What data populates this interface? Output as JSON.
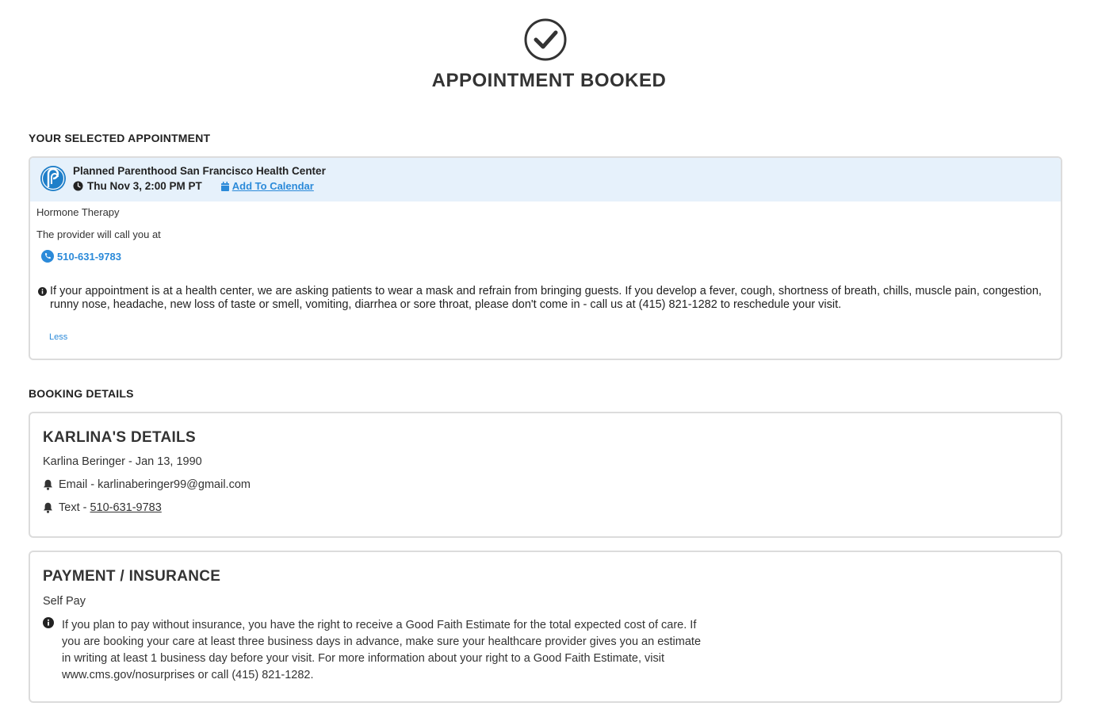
{
  "header": {
    "title": "APPOINTMENT BOOKED"
  },
  "selected_section": {
    "label": "YOUR SELECTED APPOINTMENT"
  },
  "appointment": {
    "center_name": "Planned Parenthood San Francisco Health Center",
    "datetime": "Thu Nov 3, 2:00 PM PT",
    "add_to_calendar": "Add To Calendar",
    "service": "Hormone Therapy",
    "call_note": "The provider will call you at",
    "phone": "510-631-9783",
    "covid_notice": "If your appointment is at a health center, we are asking patients to wear a mask and refrain from bringing guests. If you develop a fever, cough, shortness of breath, chills, muscle pain, congestion, runny nose, headache, new loss of taste or smell, vomiting, diarrhea or sore throat, please don't come in - call us at (415) 821-1282 to reschedule your visit.",
    "less_label": "Less"
  },
  "booking_section": {
    "label": "BOOKING DETAILS"
  },
  "patient": {
    "title": "KARLINA'S DETAILS",
    "name_dob": "Karlina Beringer - Jan 13, 1990",
    "email_line": "Email - karlinaberinger99@gmail.com",
    "text_prefix": "Text - ",
    "text_phone": "510-631-9783"
  },
  "payment": {
    "title": "PAYMENT / INSURANCE",
    "method": "Self Pay",
    "notice": "If you plan to pay without insurance, you have the right to receive a Good Faith Estimate for the total expected cost of care. If you are booking your care at least three business days in advance, make sure your healthcare provider gives you an estimate in writing at least 1 business day before your visit. For more information about your right to a Good Faith Estimate, visit www.cms.gov/nosurprises or call (415) 821-1282."
  },
  "colors": {
    "accent": "#2b8ad9",
    "header_bg": "#e6f1fb",
    "text": "#333333",
    "border": "#dcdcdc"
  },
  "icons": {
    "success": "check-circle-icon",
    "logo": "planned-parenthood-logo",
    "clock": "clock-icon",
    "calendar": "calendar-icon",
    "phone": "phone-icon",
    "info": "info-icon",
    "bell": "bell-icon"
  }
}
